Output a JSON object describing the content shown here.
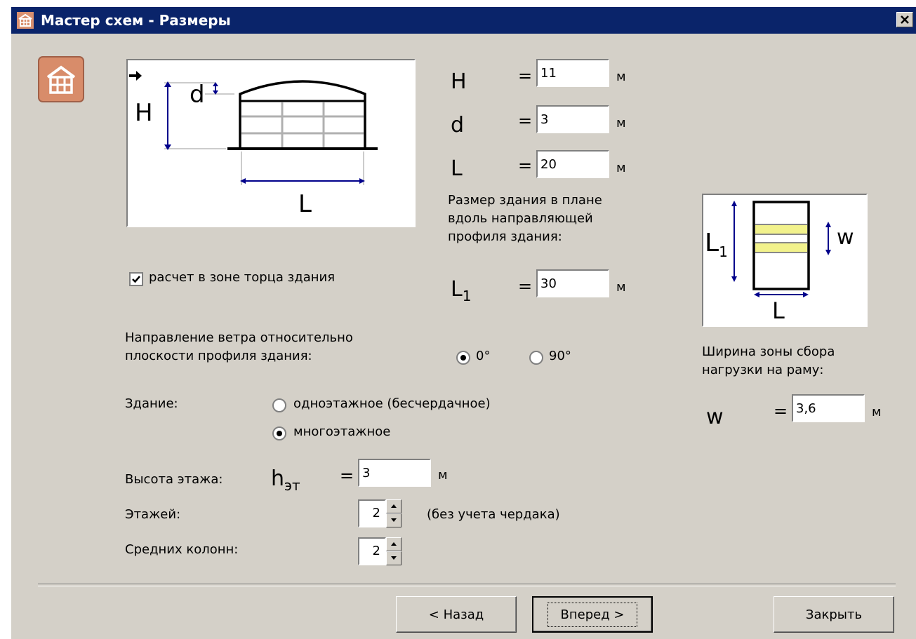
{
  "window": {
    "title": "Мастер схем - Размеры",
    "title_bg": "#0a246a",
    "face": "#d4d0c8",
    "close_icon": "close-x"
  },
  "diagram_main": {
    "H": "H",
    "d": "d",
    "L": "L"
  },
  "params": {
    "H": {
      "label": "H",
      "eq": "=",
      "value": "11",
      "unit": "м"
    },
    "d": {
      "label": "d",
      "eq": "=",
      "value": "3",
      "unit": "м"
    },
    "L": {
      "label": "L",
      "eq": "=",
      "value": "20",
      "unit": "м"
    },
    "plan_note": [
      "Размер здания в плане",
      "вдоль направляющей",
      "профиля здания:"
    ],
    "L1": {
      "label": "L",
      "sub": "1",
      "eq": "=",
      "value": "30",
      "unit": "м"
    }
  },
  "diagram_plan": {
    "L1": "L",
    "L1_sub": "1",
    "w": "w",
    "L": "L",
    "highlight": "#f2f28c"
  },
  "end_zone": {
    "label": "расчет в зоне торца здания",
    "checked": true
  },
  "wind": {
    "label": [
      "Направление ветра относительно",
      "плоскости профиля здания:"
    ],
    "options": [
      {
        "label": "0°",
        "selected": true
      },
      {
        "label": "90°",
        "selected": false
      }
    ]
  },
  "building": {
    "label": "Здание:",
    "options": [
      {
        "label": "одноэтажное (бесчердачное)",
        "selected": false
      },
      {
        "label": "многоэтажное",
        "selected": true
      }
    ]
  },
  "floor_height": {
    "label": "Высота этажа:",
    "symbol": "h",
    "sub": "эт",
    "eq": "=",
    "value": "3",
    "unit": "м"
  },
  "floors": {
    "label": "Этажей:",
    "value": "2",
    "note": "(без учета чердака)"
  },
  "columns": {
    "label": "Средних колонн:",
    "value": "2"
  },
  "load_zone": {
    "label": [
      "Ширина зоны сбора",
      "нагрузки на раму:"
    ],
    "symbol": "w",
    "eq": "=",
    "value": "3,6",
    "unit": "м"
  },
  "buttons": {
    "back": "< Назад",
    "next": "Вперед >",
    "close": "Закрыть"
  }
}
